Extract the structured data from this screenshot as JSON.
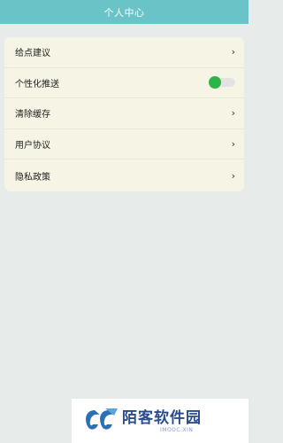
{
  "header": {
    "title": "个人中心"
  },
  "settings": {
    "items": [
      {
        "label": "给点建议",
        "control": "chevron-right-icon"
      },
      {
        "label": "个性化推送",
        "control": "toggle",
        "enabled": true
      },
      {
        "label": "清除缓存",
        "control": "chevron-right-icon"
      },
      {
        "label": "用户协议",
        "control": "chevron-right-icon"
      },
      {
        "label": "隐私政策",
        "control": "chevron-right-icon"
      }
    ],
    "chevron_glyph": "›"
  },
  "watermark": {
    "name": "陌客软件园",
    "sub": "IMOOC.XIN"
  },
  "colors": {
    "header": "#6ac3c7",
    "page_bg": "#e7ebea",
    "card_bg": "#f6f4e5",
    "toggle_on": "#2db446",
    "brand": "#2a4c8c"
  }
}
